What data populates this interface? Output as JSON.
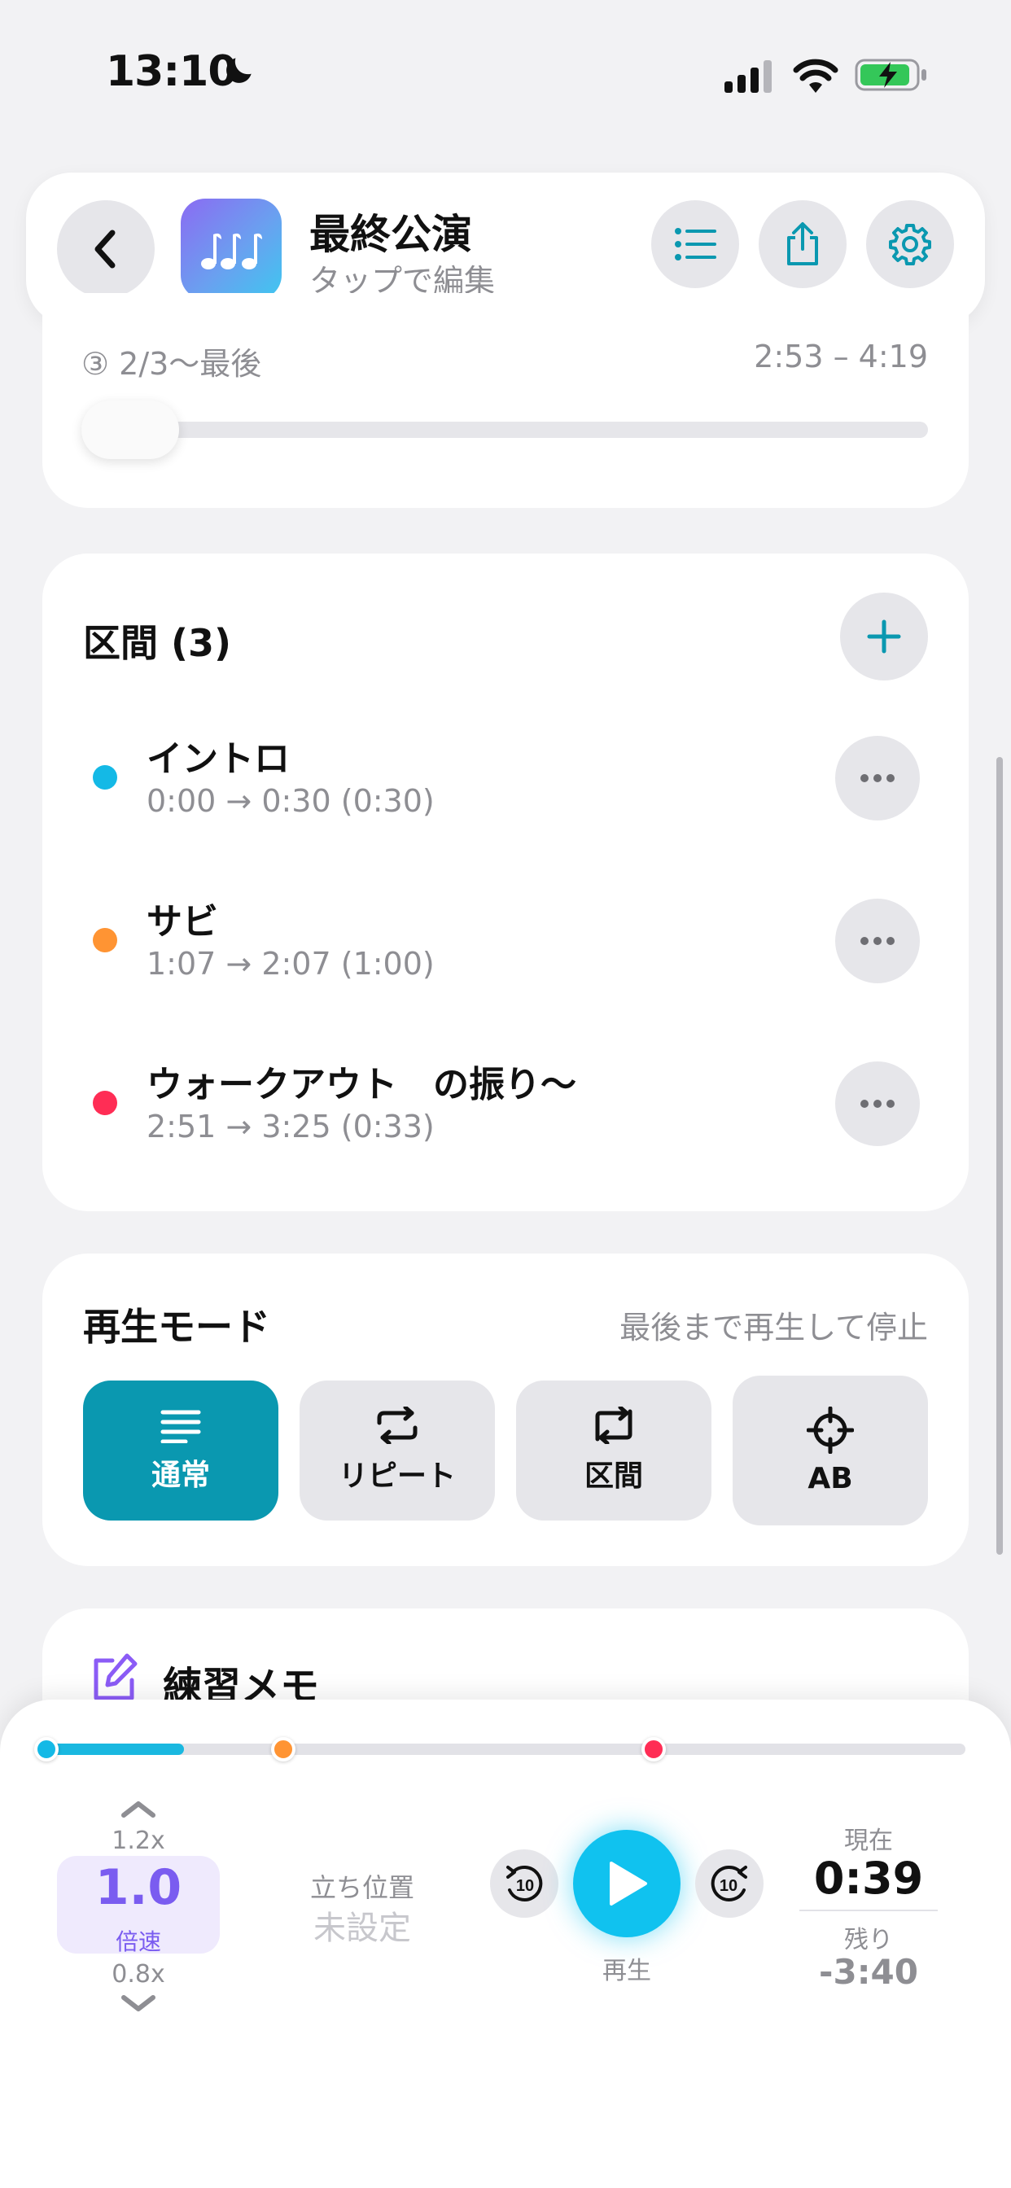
{
  "status": {
    "time": "13:10"
  },
  "header": {
    "title": "最終公演",
    "subtitle": "タップで編集"
  },
  "current_segment": {
    "label": "③ 2/3〜最後",
    "range": "2:53 – 4:19",
    "slider_value": 0
  },
  "sections": {
    "title": "区間 (3)",
    "items": [
      {
        "name": "イントロ",
        "time": "0:00 → 0:30  (0:30)",
        "color": "#14b9e6"
      },
      {
        "name": "サビ",
        "time": "1:07 → 2:07  (1:00)",
        "color": "#ff9433"
      },
      {
        "name": "ウォークアウト　の振り〜",
        "time": "2:51 → 3:25  (0:33)",
        "color": "#ff2d55"
      }
    ]
  },
  "play_mode": {
    "title": "再生モード",
    "description": "最後まで再生して停止",
    "modes": [
      {
        "label": "通常",
        "active": true
      },
      {
        "label": "リピート",
        "active": false
      },
      {
        "label": "区間",
        "active": false
      },
      {
        "label": "AB",
        "active": false
      }
    ],
    "accent": "#0a98b0"
  },
  "memo": {
    "title": "練習メモ"
  },
  "player": {
    "progress_fraction": 0.15,
    "speed": {
      "up": "1.2x",
      "value": "1.0",
      "unit": "倍速",
      "down": "0.8x"
    },
    "stand": {
      "label": "立ち位置",
      "value": "未設定"
    },
    "play_label": "再生",
    "current": {
      "label": "現在",
      "value": "0:39"
    },
    "remaining": {
      "label": "残り",
      "value": "-3:40"
    },
    "skip_back": "10",
    "skip_fwd": "10"
  }
}
